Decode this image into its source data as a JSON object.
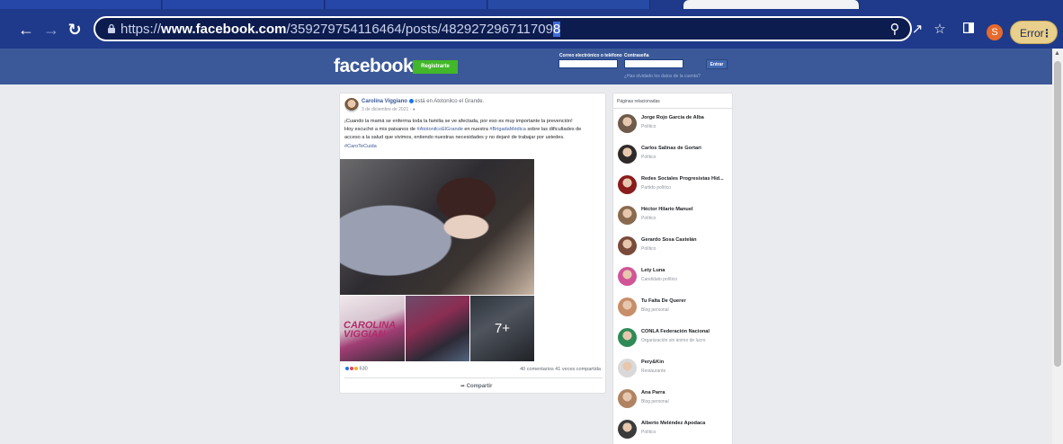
{
  "browser": {
    "url_prefix": "https://",
    "url_domain": "www.facebook.com",
    "url_path": "/359279754116464/posts/482927296711709",
    "url_end": "8",
    "profile_initial": "S",
    "error_label": "Error"
  },
  "fb_header": {
    "logo": "facebook",
    "register_label": "Registrarte",
    "email_label": "Correo electrónico o teléfono",
    "password_label": "Contraseña",
    "enter_label": "Entrar",
    "forgot_label": "¿Has olvidado los datos de la cuenta?"
  },
  "post": {
    "author": "Carolina Viggiano",
    "location_text": "está en Atotonilco el Grande.",
    "date": "3 de diciembre de 2021 · ",
    "text_line1": "¡Cuando la mamá se enferma toda la familia se ve afectada, por eso es muy importante la prevención!",
    "text_line2_a": "Hoy escuché a mis paisanos de ",
    "hash1": "#AtotonilcoElGrande",
    "text_line2_b": " en nuestra ",
    "hash2": "#BrigadaMédica",
    "text_line2_c": " sobre las dificultades de",
    "text_line3": "acceso a la salud que vivimos, entiendo nuestras necesidades y no dejaré de trabajar por ustedes.",
    "hash3": "#CaroTeCuida",
    "thumb1_text": "CAROLINA VIGGIAN",
    "more_photos": "7+",
    "reaction_count": "630",
    "stats": "40 comentarios  41 veces compartida",
    "share_label": "Compartir"
  },
  "related": {
    "title": "Páginas relacionadas",
    "items": [
      {
        "name": "Jorge Rojo García de Alba",
        "category": "Político",
        "color": "#6f5a4b"
      },
      {
        "name": "Carlos Salinas de Gortari",
        "category": "Político",
        "color": "#2f2b2a"
      },
      {
        "name": "Redes Sociales Progresistas Hid...",
        "category": "Partido político",
        "color": "#8b1c1c"
      },
      {
        "name": "Héctor Hilario Manuel",
        "category": "Político",
        "color": "#8a6a4f"
      },
      {
        "name": "Gerardo Sosa Castelán",
        "category": "Político",
        "color": "#7a4b3a"
      },
      {
        "name": "Lety Luna",
        "category": "Candidato político",
        "color": "#d05596"
      },
      {
        "name": "Tu Falta De Querer",
        "category": "Blog personal",
        "color": "#c78e6a"
      },
      {
        "name": "CONLA Federación Nacional",
        "category": "Organización sin ánimo de lucro",
        "color": "#2e8b57"
      },
      {
        "name": "Pery&Kin",
        "category": "Restaurante",
        "color": "#d9d9d9"
      },
      {
        "name": "Ana Parra",
        "category": "Blog personal",
        "color": "#b08363"
      },
      {
        "name": "Alberto Meléndez Apodaca",
        "category": "Político",
        "color": "#3b3b3b"
      }
    ]
  }
}
